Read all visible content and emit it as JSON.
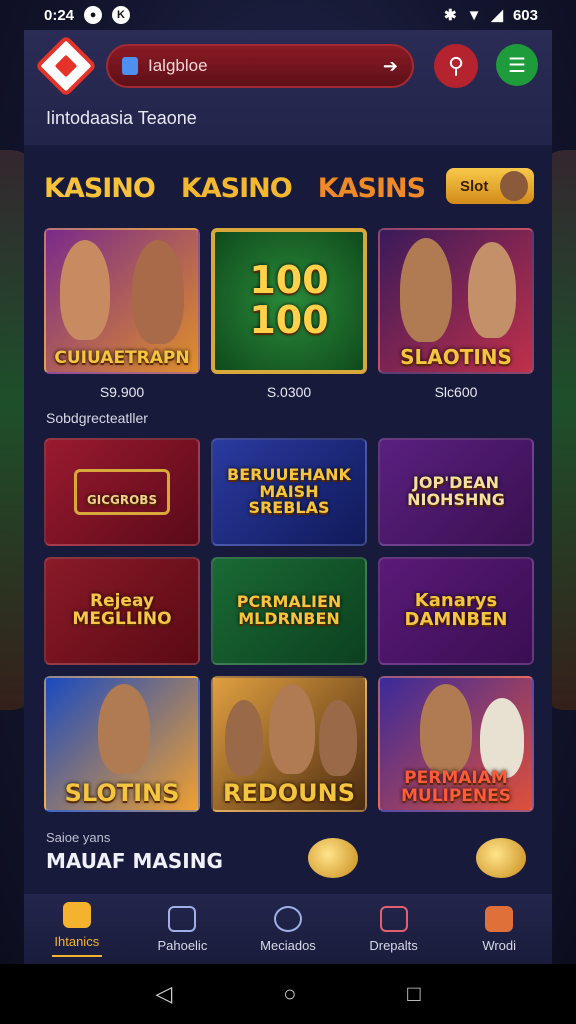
{
  "status": {
    "time": "0:24",
    "battery": "603"
  },
  "header": {
    "search_text": "Ialgbloe",
    "subtitle": "Iintodaasia Teaone"
  },
  "tabs": [
    "KASINO",
    "KASINO",
    "KASINS"
  ],
  "slot_chip": "Slot",
  "row1": [
    {
      "title": "CUIUAETRAPN",
      "price": "S9.900",
      "theme": "#6a2a7a"
    },
    {
      "title": "100\n100",
      "price": "S.0300",
      "theme": "#1a5a2a"
    },
    {
      "title": "SLAOTINS",
      "price": "Slc600",
      "theme": "#4a1a5a"
    }
  ],
  "section_label": "Sobdgrecteatller",
  "row2": [
    {
      "title": "GICGROBS",
      "theme": "#7a1428"
    },
    {
      "title": "BERUUEHANK MAISH SREBLAS",
      "theme": "#1e2a7a"
    },
    {
      "title": "JOP'DEAN NIOHSHNG",
      "theme": "#4a1a6a"
    }
  ],
  "row3": [
    {
      "title": "Rejeay MEGLLINO",
      "theme": "#7a1824"
    },
    {
      "title": "PCRMALIEN MLDRNBEN",
      "theme": "#12502a"
    },
    {
      "title": "Kanarys DAMNBEN",
      "theme": "#4a1660"
    }
  ],
  "row4": [
    {
      "title": "SLOTINS",
      "theme": "#1a3a9a"
    },
    {
      "title": "REDOUNS",
      "theme": "#5a3a1a"
    },
    {
      "title": "PERMAIAM MULIPENES",
      "theme": "#3a1a6a"
    }
  ],
  "promo": {
    "small": "Saioe yans",
    "big": "MAUAF MASING"
  },
  "nav": [
    {
      "label": "Ihtanics",
      "icon": "home-icon",
      "active": true
    },
    {
      "label": "Pahoelic",
      "icon": "document-icon",
      "active": false
    },
    {
      "label": "Meciados",
      "icon": "chat-icon",
      "active": false
    },
    {
      "label": "Drepalts",
      "icon": "edit-icon",
      "active": false
    },
    {
      "label": "Wrodi",
      "icon": "mail-icon",
      "active": false
    }
  ],
  "colors": {
    "accent": "#f5b22e",
    "search_bg": "#8a1a24",
    "profile_bg": "#1e9b3a"
  }
}
